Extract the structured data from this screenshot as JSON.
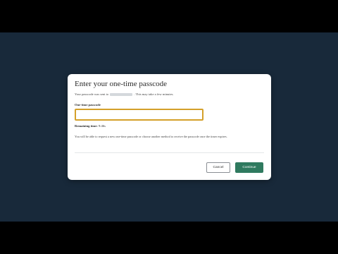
{
  "modal": {
    "title": "Enter your one-time passcode",
    "sent_prefix": "Your passcode was sent to",
    "sent_suffix": ". This may take a few minutes.",
    "field_label": "One-time passcode",
    "input_value": "",
    "input_placeholder": "",
    "remaining_label": "Remaining time:",
    "remaining_value": "9:46s",
    "info_text": "You will be able to request a new one-time passcode or choose another method to receive the passcode once the timer expires.",
    "cancel_label": "Cancel",
    "continue_label": "Continue"
  },
  "colors": {
    "background": "#18293a",
    "letterbox": "#000000",
    "input_focus_border": "#d4a02a",
    "primary_button": "#2f7a5f"
  }
}
